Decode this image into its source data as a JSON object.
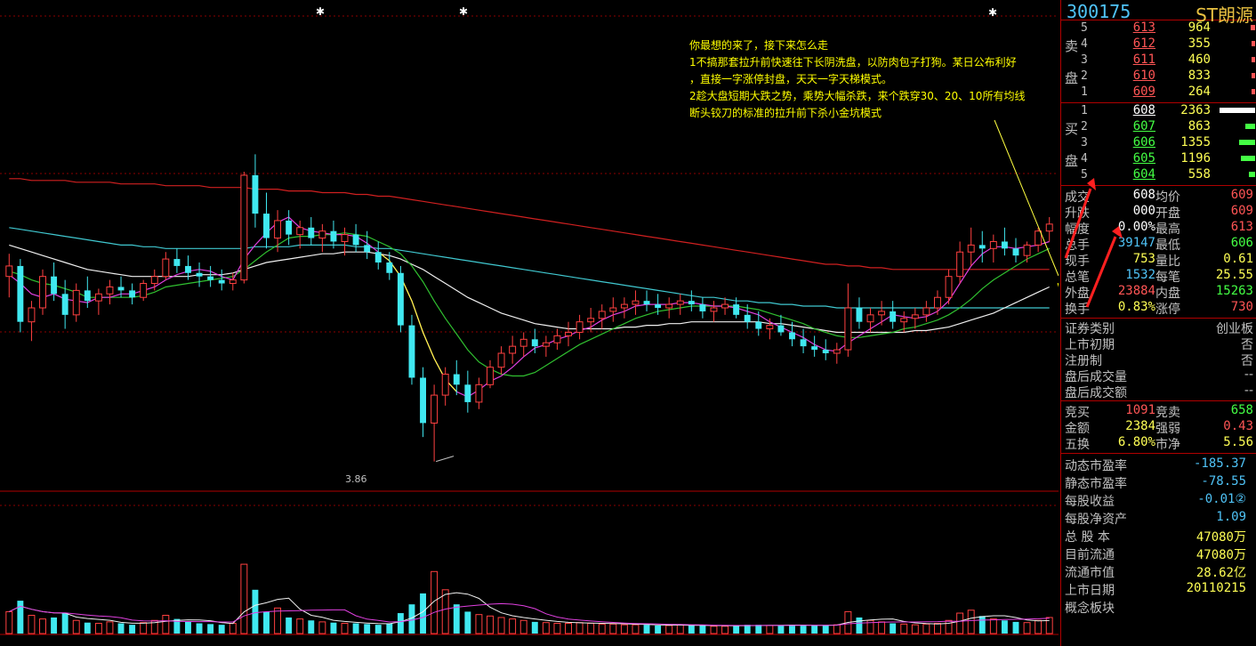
{
  "stock": {
    "code": "300175",
    "name": "ST朗源"
  },
  "orderbook": {
    "sell_label": [
      "卖",
      "盘"
    ],
    "buy_label": [
      "买",
      "盘"
    ],
    "sell": [
      {
        "level": "5",
        "price": "613",
        "volume": "964",
        "bar": 0.12
      },
      {
        "level": "4",
        "price": "612",
        "volume": "355",
        "bar": 0.05
      },
      {
        "level": "3",
        "price": "611",
        "volume": "460",
        "bar": 0.06
      },
      {
        "level": "2",
        "price": "610",
        "volume": "833",
        "bar": 0.1
      },
      {
        "level": "1",
        "price": "609",
        "volume": "264",
        "bar": 0.04
      }
    ],
    "buy": [
      {
        "level": "1",
        "price": "608",
        "volume": "2363",
        "bar": 1.0
      },
      {
        "level": "2",
        "price": "607",
        "volume": "863",
        "bar": 0.28
      },
      {
        "level": "3",
        "price": "606",
        "volume": "1355",
        "bar": 0.45
      },
      {
        "level": "4",
        "price": "605",
        "volume": "1196",
        "bar": 0.4
      },
      {
        "level": "5",
        "price": "604",
        "volume": "558",
        "bar": 0.18
      }
    ]
  },
  "quote": [
    {
      "l1": "成交",
      "v1": "608",
      "c1": "white",
      "l2": "均价",
      "v2": "609",
      "c2": "red"
    },
    {
      "l1": "升跌",
      "v1": "000",
      "c1": "white",
      "l2": "开盘",
      "v2": "609",
      "c2": "red"
    },
    {
      "l1": "幅度",
      "v1": "0.00%",
      "c1": "white",
      "l2": "最高",
      "v2": "613",
      "c2": "red"
    },
    {
      "l1": "总手",
      "v1": "39147",
      "c1": "cyan",
      "l2": "最低",
      "v2": "606",
      "c2": "green"
    },
    {
      "l1": "现手",
      "v1": "753",
      "c1": "yellow",
      "l2": "量比",
      "v2": "0.61",
      "c2": "yellow"
    },
    {
      "l1": "总笔",
      "v1": "1532",
      "c1": "cyan",
      "l2": "每笔",
      "v2": "25.55",
      "c2": "yellow"
    },
    {
      "l1": "外盘",
      "v1": "23884",
      "c1": "red",
      "l2": "内盘",
      "v2": "15263",
      "c2": "green"
    },
    {
      "l1": "换手",
      "v1": "0.83%",
      "c1": "yellow",
      "l2": "涨停",
      "v2": "730",
      "c2": "red"
    }
  ],
  "info": [
    {
      "label": "证券类别",
      "value": "创业板"
    },
    {
      "label": "上市初期",
      "value": "否"
    },
    {
      "label": "注册制",
      "value": "否"
    },
    {
      "label": "盘后成交量",
      "value": "--"
    },
    {
      "label": "盘后成交额",
      "value": "--"
    }
  ],
  "auction": [
    {
      "l1": "竞买",
      "v1": "1091",
      "c1": "red",
      "l2": "竞卖",
      "v2": "658",
      "c2": "green"
    },
    {
      "l1": "金额",
      "v1": "2384",
      "c1": "yellow",
      "l2": "强弱",
      "v2": "0.43",
      "c2": "red"
    },
    {
      "l1": "五换",
      "v1": "6.80%",
      "c1": "yellow",
      "l2": "市净",
      "v2": "5.56",
      "c2": "yellow"
    }
  ],
  "fundamentals": [
    {
      "label": "动态市盈率",
      "value": "-185.37",
      "color": "cyan"
    },
    {
      "label": "静态市盈率",
      "value": "-78.55",
      "color": "cyan"
    },
    {
      "label": "每股收益",
      "value": "-0.01②",
      "color": "cyan"
    },
    {
      "label": "每股净资产",
      "value": "1.09",
      "color": "cyan"
    },
    {
      "label": "总 股 本",
      "value": "47080万",
      "color": "yellow"
    },
    {
      "label": "目前流通",
      "value": "47080万",
      "color": "yellow"
    },
    {
      "label": "流通市值",
      "value": "28.62亿",
      "color": "yellow"
    },
    {
      "label": "上市日期",
      "value": "20110215",
      "color": "yellow"
    },
    {
      "label": "概念板块",
      "value": "",
      "color": "yellow"
    }
  ],
  "annotation": {
    "lines": [
      "你最想的来了，接下来怎么走",
      "1不搞那套拉升前快速往下长阴洗盘，以防肉包子打狗。某日公布利好",
      "，直接一字涨停封盘，天天一字天梯模式。",
      "2趁大盘短期大跌之势，乘势大幅杀跌，来个跌穿30、20、10所有均线",
      "断头铰刀的标准的拉升前下杀小金坑模式"
    ]
  },
  "chart_data": {
    "type": "candlestick",
    "low_label": "3.86",
    "candles": [
      [
        4.92,
        5.05,
        4.8,
        4.98
      ],
      [
        4.98,
        5.02,
        4.6,
        4.66
      ],
      [
        4.66,
        4.78,
        4.55,
        4.74
      ],
      [
        4.74,
        4.96,
        4.7,
        4.92
      ],
      [
        4.92,
        5.0,
        4.78,
        4.82
      ],
      [
        4.82,
        4.9,
        4.62,
        4.7
      ],
      [
        4.7,
        4.88,
        4.66,
        4.84
      ],
      [
        4.84,
        4.92,
        4.74,
        4.78
      ],
      [
        4.78,
        4.85,
        4.7,
        4.82
      ],
      [
        4.82,
        4.9,
        4.76,
        4.86
      ],
      [
        4.86,
        4.92,
        4.8,
        4.84
      ],
      [
        4.84,
        4.88,
        4.76,
        4.8
      ],
      [
        4.8,
        4.9,
        4.78,
        4.88
      ],
      [
        4.88,
        4.96,
        4.84,
        4.92
      ],
      [
        4.92,
        5.06,
        4.9,
        5.02
      ],
      [
        5.02,
        5.08,
        4.94,
        4.98
      ],
      [
        4.98,
        5.04,
        4.9,
        4.94
      ],
      [
        4.94,
        5.0,
        4.86,
        4.92
      ],
      [
        4.92,
        4.98,
        4.86,
        4.9
      ],
      [
        4.9,
        4.96,
        4.84,
        4.88
      ],
      [
        4.88,
        4.94,
        4.84,
        4.9
      ],
      [
        4.9,
        5.52,
        4.88,
        5.5
      ],
      [
        5.5,
        5.62,
        5.2,
        5.28
      ],
      [
        5.28,
        5.4,
        5.08,
        5.14
      ],
      [
        5.14,
        5.3,
        5.06,
        5.24
      ],
      [
        5.24,
        5.3,
        5.1,
        5.16
      ],
      [
        5.16,
        5.24,
        5.08,
        5.2
      ],
      [
        5.2,
        5.26,
        5.1,
        5.14
      ],
      [
        5.14,
        5.22,
        5.06,
        5.18
      ],
      [
        5.18,
        5.24,
        5.08,
        5.12
      ],
      [
        5.12,
        5.2,
        5.04,
        5.16
      ],
      [
        5.16,
        5.22,
        5.06,
        5.1
      ],
      [
        5.1,
        5.18,
        5.02,
        5.06
      ],
      [
        5.06,
        5.12,
        4.96,
        5.0
      ],
      [
        5.0,
        5.06,
        4.9,
        4.94
      ],
      [
        4.94,
        4.98,
        4.6,
        4.64
      ],
      [
        4.64,
        4.7,
        4.3,
        4.34
      ],
      [
        4.34,
        4.4,
        4.0,
        4.08
      ],
      [
        4.08,
        4.3,
        3.86,
        4.24
      ],
      [
        4.24,
        4.4,
        4.18,
        4.36
      ],
      [
        4.36,
        4.44,
        4.24,
        4.3
      ],
      [
        4.3,
        4.38,
        4.14,
        4.2
      ],
      [
        4.2,
        4.34,
        4.16,
        4.3
      ],
      [
        4.3,
        4.44,
        4.28,
        4.4
      ],
      [
        4.4,
        4.52,
        4.36,
        4.48
      ],
      [
        4.48,
        4.58,
        4.42,
        4.52
      ],
      [
        4.52,
        4.6,
        4.46,
        4.56
      ],
      [
        4.56,
        4.62,
        4.48,
        4.52
      ],
      [
        4.52,
        4.58,
        4.46,
        4.54
      ],
      [
        4.54,
        4.62,
        4.5,
        4.58
      ],
      [
        4.58,
        4.66,
        4.52,
        4.6
      ],
      [
        4.6,
        4.7,
        4.56,
        4.66
      ],
      [
        4.66,
        4.74,
        4.6,
        4.68
      ],
      [
        4.68,
        4.76,
        4.62,
        4.72
      ],
      [
        4.72,
        4.8,
        4.66,
        4.74
      ],
      [
        4.74,
        4.8,
        4.68,
        4.76
      ],
      [
        4.76,
        4.84,
        4.7,
        4.78
      ],
      [
        4.78,
        4.84,
        4.72,
        4.76
      ],
      [
        4.76,
        4.82,
        4.7,
        4.74
      ],
      [
        4.74,
        4.8,
        4.68,
        4.76
      ],
      [
        4.76,
        4.82,
        4.7,
        4.78
      ],
      [
        4.78,
        4.84,
        4.72,
        4.76
      ],
      [
        4.76,
        4.8,
        4.68,
        4.72
      ],
      [
        4.72,
        4.78,
        4.66,
        4.74
      ],
      [
        4.74,
        4.8,
        4.7,
        4.76
      ],
      [
        4.76,
        4.8,
        4.68,
        4.7
      ],
      [
        4.7,
        4.76,
        4.62,
        4.66
      ],
      [
        4.66,
        4.72,
        4.58,
        4.62
      ],
      [
        4.62,
        4.68,
        4.56,
        4.64
      ],
      [
        4.64,
        4.7,
        4.58,
        4.6
      ],
      [
        4.6,
        4.66,
        4.52,
        4.56
      ],
      [
        4.56,
        4.62,
        4.48,
        4.52
      ],
      [
        4.52,
        4.58,
        4.46,
        4.5
      ],
      [
        4.5,
        4.56,
        4.44,
        4.48
      ],
      [
        4.48,
        4.54,
        4.42,
        4.5
      ],
      [
        4.5,
        4.88,
        4.46,
        4.74
      ],
      [
        4.74,
        4.8,
        4.62,
        4.66
      ],
      [
        4.66,
        4.74,
        4.6,
        4.7
      ],
      [
        4.7,
        4.78,
        4.64,
        4.72
      ],
      [
        4.72,
        4.78,
        4.62,
        4.66
      ],
      [
        4.66,
        4.72,
        4.6,
        4.68
      ],
      [
        4.68,
        4.74,
        4.62,
        4.7
      ],
      [
        4.7,
        4.78,
        4.66,
        4.74
      ],
      [
        4.74,
        4.84,
        4.7,
        4.8
      ],
      [
        4.8,
        4.96,
        4.76,
        4.92
      ],
      [
        4.92,
        5.12,
        4.88,
        5.06
      ],
      [
        5.06,
        5.2,
        4.98,
        5.1
      ],
      [
        5.1,
        5.18,
        5.0,
        5.08
      ],
      [
        5.08,
        5.16,
        5.0,
        5.12
      ],
      [
        5.12,
        5.2,
        5.04,
        5.08
      ],
      [
        5.08,
        5.14,
        5.0,
        5.04
      ],
      [
        5.04,
        5.12,
        5.0,
        5.1
      ],
      [
        5.1,
        5.2,
        5.06,
        5.18
      ],
      [
        5.18,
        5.26,
        5.12,
        5.22
      ]
    ],
    "ma5": [
      4.93,
      4.88,
      4.82,
      4.8,
      4.82,
      4.79,
      4.78,
      4.77,
      4.8,
      4.8,
      4.82,
      4.82,
      4.84,
      4.86,
      4.9,
      4.93,
      4.95,
      4.96,
      4.95,
      4.92,
      4.9,
      5.02,
      5.1,
      5.17,
      5.23,
      5.26,
      5.2,
      5.18,
      5.17,
      5.16,
      5.16,
      5.15,
      5.11,
      5.06,
      5.01,
      4.92,
      4.78,
      4.6,
      4.45,
      4.33,
      4.26,
      4.23,
      4.27,
      4.32,
      4.35,
      4.4,
      4.46,
      4.51,
      4.53,
      4.56,
      4.58,
      4.61,
      4.63,
      4.67,
      4.7,
      4.72,
      4.75,
      4.76,
      4.76,
      4.76,
      4.77,
      4.77,
      4.76,
      4.75,
      4.75,
      4.74,
      4.72,
      4.7,
      4.66,
      4.63,
      4.6,
      4.57,
      4.53,
      4.5,
      4.49,
      4.54,
      4.58,
      4.62,
      4.66,
      4.7,
      4.69,
      4.68,
      4.69,
      4.72,
      4.78,
      4.88,
      4.98,
      5.05,
      5.09,
      5.09,
      5.08,
      5.09,
      5.1,
      5.12
    ],
    "ma10": [
      4.95,
      4.93,
      4.9,
      4.88,
      4.87,
      4.85,
      4.83,
      4.8,
      4.8,
      4.8,
      4.8,
      4.8,
      4.81,
      4.83,
      4.86,
      4.87,
      4.88,
      4.89,
      4.9,
      4.91,
      4.92,
      4.96,
      5.01,
      5.06,
      5.1,
      5.14,
      5.15,
      5.15,
      5.16,
      5.16,
      5.17,
      5.16,
      5.15,
      5.12,
      5.09,
      5.05,
      4.98,
      4.89,
      4.78,
      4.68,
      4.59,
      4.5,
      4.43,
      4.39,
      4.36,
      4.35,
      4.35,
      4.37,
      4.41,
      4.45,
      4.49,
      4.53,
      4.56,
      4.59,
      4.62,
      4.65,
      4.68,
      4.7,
      4.72,
      4.73,
      4.74,
      4.75,
      4.75,
      4.75,
      4.75,
      4.75,
      4.74,
      4.73,
      4.71,
      4.69,
      4.67,
      4.65,
      4.62,
      4.6,
      4.58,
      4.57,
      4.57,
      4.58,
      4.59,
      4.6,
      4.62,
      4.63,
      4.65,
      4.67,
      4.7,
      4.74,
      4.79,
      4.85,
      4.9,
      4.94,
      4.98,
      5.02,
      5.05,
      5.08
    ],
    "ma30": [
      5.1,
      5.08,
      5.06,
      5.04,
      5.02,
      5.0,
      4.98,
      4.96,
      4.95,
      4.94,
      4.93,
      4.92,
      4.92,
      4.92,
      4.92,
      4.92,
      4.92,
      4.93,
      4.93,
      4.93,
      4.94,
      4.96,
      4.98,
      5.0,
      5.01,
      5.02,
      5.03,
      5.04,
      5.05,
      5.05,
      5.06,
      5.06,
      5.06,
      5.05,
      5.04,
      5.02,
      4.99,
      4.96,
      4.92,
      4.88,
      4.84,
      4.8,
      4.77,
      4.74,
      4.71,
      4.69,
      4.67,
      4.65,
      4.64,
      4.63,
      4.62,
      4.62,
      4.62,
      4.62,
      4.62,
      4.63,
      4.63,
      4.64,
      4.64,
      4.65,
      4.65,
      4.66,
      4.66,
      4.66,
      4.66,
      4.66,
      4.66,
      4.66,
      4.65,
      4.65,
      4.64,
      4.63,
      4.62,
      4.61,
      4.6,
      4.6,
      4.6,
      4.6,
      4.6,
      4.6,
      4.6,
      4.61,
      4.61,
      4.62,
      4.63,
      4.65,
      4.67,
      4.69,
      4.71,
      4.74,
      4.77,
      4.8,
      4.83,
      4.86
    ],
    "ma60": [
      5.2,
      5.19,
      5.18,
      5.17,
      5.16,
      5.15,
      5.14,
      5.13,
      5.12,
      5.11,
      5.1,
      5.1,
      5.09,
      5.09,
      5.08,
      5.08,
      5.08,
      5.08,
      5.08,
      5.08,
      5.08,
      5.08,
      5.09,
      5.09,
      5.09,
      5.09,
      5.1,
      5.1,
      5.1,
      5.1,
      5.1,
      5.09,
      5.09,
      5.08,
      5.08,
      5.07,
      5.06,
      5.05,
      5.04,
      5.03,
      5.02,
      5.01,
      5.0,
      4.99,
      4.98,
      4.97,
      4.96,
      4.95,
      4.94,
      4.93,
      4.92,
      4.91,
      4.9,
      4.89,
      4.88,
      4.87,
      4.86,
      4.85,
      4.84,
      4.83,
      4.82,
      4.81,
      4.8,
      4.8,
      4.79,
      4.78,
      4.78,
      4.77,
      4.77,
      4.76,
      4.76,
      4.75,
      4.75,
      4.75,
      4.74,
      4.74,
      4.74,
      4.74,
      4.74,
      4.74,
      4.74,
      4.74,
      4.74,
      4.74,
      4.74,
      4.74,
      4.74,
      4.74,
      4.74,
      4.74,
      4.74,
      4.74,
      4.74,
      4.74
    ],
    "ma120": [
      5.48,
      5.48,
      5.47,
      5.47,
      5.47,
      5.47,
      5.46,
      5.46,
      5.46,
      5.46,
      5.45,
      5.45,
      5.45,
      5.45,
      5.44,
      5.44,
      5.44,
      5.44,
      5.43,
      5.43,
      5.43,
      5.43,
      5.42,
      5.42,
      5.42,
      5.41,
      5.41,
      5.41,
      5.4,
      5.4,
      5.4,
      5.39,
      5.39,
      5.38,
      5.38,
      5.37,
      5.36,
      5.35,
      5.34,
      5.33,
      5.32,
      5.31,
      5.3,
      5.29,
      5.28,
      5.27,
      5.26,
      5.25,
      5.24,
      5.23,
      5.22,
      5.21,
      5.2,
      5.19,
      5.18,
      5.17,
      5.16,
      5.15,
      5.14,
      5.13,
      5.12,
      5.11,
      5.1,
      5.09,
      5.08,
      5.07,
      5.06,
      5.05,
      5.04,
      5.03,
      5.02,
      5.01,
      5.0,
      4.99,
      4.99,
      4.98,
      4.98,
      4.97,
      4.97,
      4.96,
      4.96,
      4.96,
      4.96,
      4.96,
      4.96,
      4.96,
      4.96,
      4.96,
      4.96,
      4.96,
      4.96,
      4.96,
      4.96,
      4.96
    ],
    "volume": [
      30,
      45,
      25,
      20,
      22,
      28,
      18,
      15,
      14,
      16,
      14,
      12,
      15,
      18,
      25,
      20,
      16,
      14,
      13,
      12,
      14,
      95,
      60,
      30,
      35,
      22,
      20,
      18,
      16,
      15,
      14,
      14,
      13,
      12,
      14,
      28,
      40,
      55,
      85,
      60,
      40,
      30,
      26,
      24,
      22,
      20,
      18,
      16,
      15,
      14,
      14,
      15,
      14,
      13,
      13,
      12,
      12,
      12,
      11,
      11,
      12,
      11,
      11,
      10,
      10,
      11,
      12,
      12,
      11,
      11,
      12,
      12,
      11,
      11,
      12,
      30,
      22,
      18,
      16,
      14,
      13,
      12,
      13,
      14,
      18,
      28,
      32,
      24,
      20,
      18,
      16,
      15,
      18,
      22
    ],
    "yrange": [
      3.7,
      6.3
    ],
    "vrange": [
      0,
      100
    ]
  }
}
